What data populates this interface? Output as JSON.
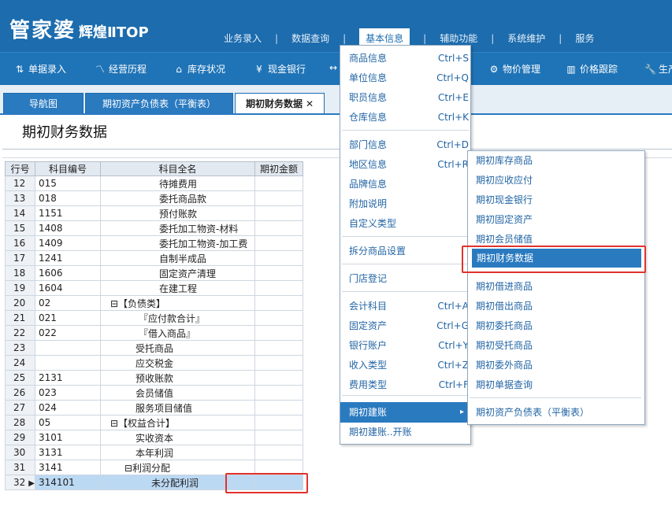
{
  "app": {
    "logo": "管家婆",
    "logo_sub": "辉煌ⅡTOP"
  },
  "topnav": {
    "items": [
      "业务录入",
      "数据查询",
      "基本信息",
      "辅助功能",
      "系统维护",
      "服务"
    ],
    "separator": "|",
    "active": "基本信息"
  },
  "toolbar": {
    "items": [
      {
        "label": "单据录入",
        "icon": "document-entry-icon",
        "glyph": "⇅"
      },
      {
        "label": "经营历程",
        "icon": "line-chart-icon",
        "glyph": "〽"
      },
      {
        "label": "库存状况",
        "icon": "warehouse-icon",
        "glyph": "⌂"
      },
      {
        "label": "现金银行",
        "icon": "yen-icon",
        "glyph": "¥"
      },
      {
        "label": "",
        "icon": "arrow-icon",
        "glyph": "↔"
      },
      {
        "label": "物价管理",
        "icon": "gear-icon",
        "glyph": "⚙"
      },
      {
        "label": "价格跟踪",
        "icon": "bar-chart-icon",
        "glyph": "▥"
      },
      {
        "label": "生产",
        "icon": "wrench-icon",
        "glyph": "🔧"
      }
    ]
  },
  "tabs": [
    {
      "label": "导航图"
    },
    {
      "label": "期初资产负债表（平衡表）"
    },
    {
      "label": "期初财务数据",
      "close": "✕",
      "active": true
    }
  ],
  "page": {
    "title": "期初财务数据"
  },
  "grid": {
    "columns": [
      "行号",
      "科目编号",
      "科目全名",
      "期初金额"
    ],
    "rows": [
      {
        "no": "12",
        "code": "015",
        "name": "待摊费用",
        "amount": ""
      },
      {
        "no": "13",
        "code": "018",
        "name": "委托商品款",
        "amount": ""
      },
      {
        "no": "14",
        "code": "1151",
        "name": "预付账款",
        "amount": ""
      },
      {
        "no": "15",
        "code": "1408",
        "name": "委托加工物资-材料",
        "amount": ""
      },
      {
        "no": "16",
        "code": "1409",
        "name": "委托加工物资-加工费",
        "amount": ""
      },
      {
        "no": "17",
        "code": "1241",
        "name": "自制半成品",
        "amount": ""
      },
      {
        "no": "18",
        "code": "1606",
        "name": "固定资产清理",
        "amount": ""
      },
      {
        "no": "19",
        "code": "1604",
        "name": "在建工程",
        "amount": ""
      },
      {
        "no": "20",
        "code": "02",
        "name": "⊟【负债类】",
        "amount": ""
      },
      {
        "no": "21",
        "code": "021",
        "name": "『应付款合计』",
        "amount": ""
      },
      {
        "no": "22",
        "code": "022",
        "name": "『借入商品』",
        "amount": ""
      },
      {
        "no": "23",
        "code": "",
        "name": "受托商品",
        "amount": ""
      },
      {
        "no": "24",
        "code": "",
        "name": "应交税金",
        "amount": ""
      },
      {
        "no": "25",
        "code": "2131",
        "name": "预收账款",
        "amount": ""
      },
      {
        "no": "26",
        "code": "023",
        "name": "会员储值",
        "amount": ""
      },
      {
        "no": "27",
        "code": "024",
        "name": "服务项目储值",
        "amount": ""
      },
      {
        "no": "28",
        "code": "05",
        "name": "⊟【权益合计】",
        "amount": ""
      },
      {
        "no": "29",
        "code": "3101",
        "name": "实收资本",
        "amount": ""
      },
      {
        "no": "30",
        "code": "3131",
        "name": "本年利润",
        "amount": ""
      },
      {
        "no": "31",
        "code": "3141",
        "name": "⊟利润分配",
        "amount": ""
      },
      {
        "no": "32",
        "code": "314101",
        "name": "未分配利润",
        "amount": "",
        "selected": true,
        "pointer": "▶"
      }
    ]
  },
  "menu": {
    "items": [
      {
        "label": "商品信息",
        "shortcut": "Ctrl+S"
      },
      {
        "label": "单位信息",
        "shortcut": "Ctrl+Q"
      },
      {
        "label": "职员信息",
        "shortcut": "Ctrl+E"
      },
      {
        "label": "仓库信息",
        "shortcut": "Ctrl+K"
      },
      {
        "label": "部门信息",
        "shortcut": "Ctrl+D"
      },
      {
        "label": "地区信息",
        "shortcut": "Ctrl+R"
      },
      {
        "label": "品牌信息",
        "shortcut": ""
      },
      {
        "label": "附加说明",
        "shortcut": ""
      },
      {
        "label": "自定义类型",
        "shortcut": ""
      },
      {
        "label": "拆分商品设置",
        "shortcut": ""
      },
      {
        "label": "门店登记",
        "shortcut": ""
      },
      {
        "label": "会计科目",
        "shortcut": "Ctrl+A"
      },
      {
        "label": "固定资产",
        "shortcut": "Ctrl+G"
      },
      {
        "label": "银行账户",
        "shortcut": "Ctrl+Y"
      },
      {
        "label": "收入类型",
        "shortcut": "Ctrl+Z"
      },
      {
        "label": "费用类型",
        "shortcut": "Ctrl+F"
      },
      {
        "label": "期初建账",
        "shortcut": "",
        "arrow": "▸"
      },
      {
        "label": "期初建账..开账",
        "shortcut": ""
      }
    ]
  },
  "submenu": {
    "items": [
      {
        "label": "期初库存商品"
      },
      {
        "label": "期初应收应付"
      },
      {
        "label": "期初现金银行"
      },
      {
        "label": "期初固定资产"
      },
      {
        "label": "期初会员储值"
      },
      {
        "label": "期初财务数据"
      },
      {
        "label": "期初借进商品"
      },
      {
        "label": "期初借出商品"
      },
      {
        "label": "期初委托商品"
      },
      {
        "label": "期初受托商品"
      },
      {
        "label": "期初委外商品"
      },
      {
        "label": "期初单据查询"
      },
      {
        "label": "期初资产负债表（平衡表）"
      }
    ]
  },
  "colors": {
    "primary": "#1c6cae",
    "highlight": "#2a7ac0",
    "annotation": "#e0332c",
    "selected_row": "#bcd9f4"
  }
}
